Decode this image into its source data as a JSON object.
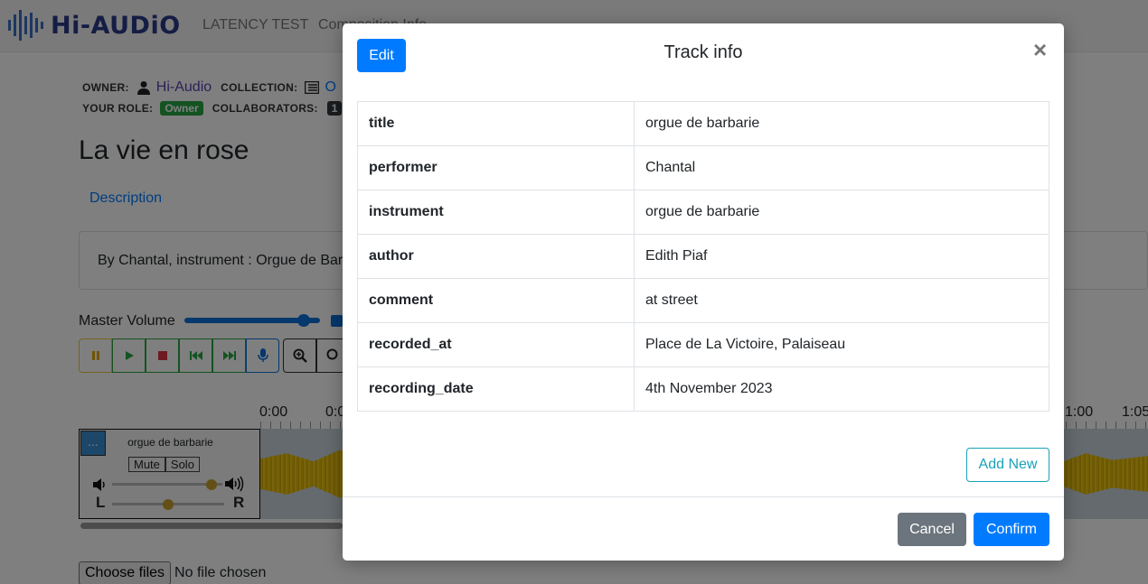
{
  "app": {
    "brand": "Hi-AUDiO",
    "nav": [
      "LATENCY TEST",
      "Composition Info"
    ]
  },
  "meta": {
    "owner_label": "OWNER:",
    "owner_value": "Hi-Audio",
    "collection_label": "COLLECTION:",
    "collection_value": "O",
    "role_label": "YOUR ROLE:",
    "role_badge": "Owner",
    "collaborators_label": "COLLABORATORS:",
    "collaborators_count": "1"
  },
  "composition": {
    "title": "La vie en rose",
    "description_tab": "Description",
    "description_text": "By Chantal, instrument : Orgue de Bar"
  },
  "player": {
    "master_volume_label": "Master Volume",
    "master_volume_level": 0.88,
    "time_ticks": [
      "0:00",
      "0:0",
      "1:00",
      "1:05"
    ]
  },
  "track": {
    "menu_label": "...",
    "name": "orgue de barbarie",
    "mute_label": "Mute",
    "solo_label": "Solo",
    "pan_left": "L",
    "pan_right": "R",
    "volume_level": 0.9,
    "pan_level": 0.5
  },
  "file_input": {
    "button_label": "Choose files",
    "status": "No file chosen"
  },
  "modal": {
    "edit_label": "Edit",
    "title": "Track info",
    "close_label": "×",
    "rows": [
      {
        "key": "title",
        "value": "orgue de barbarie"
      },
      {
        "key": "performer",
        "value": "Chantal"
      },
      {
        "key": "instrument",
        "value": "orgue de barbarie"
      },
      {
        "key": "author",
        "value": "Edith Piaf"
      },
      {
        "key": "comment",
        "value": "at street"
      },
      {
        "key": "recorded_at",
        "value": "Place de La Victoire, Palaiseau"
      },
      {
        "key": "recording_date",
        "value": "4th November 2023"
      }
    ],
    "add_new_label": "Add New",
    "cancel_label": "Cancel",
    "confirm_label": "Confirm"
  },
  "colors": {
    "primary": "#007bff",
    "secondary": "#6c757d",
    "info": "#17a2b8",
    "success": "#28a745",
    "waveform": "#e0b800"
  }
}
